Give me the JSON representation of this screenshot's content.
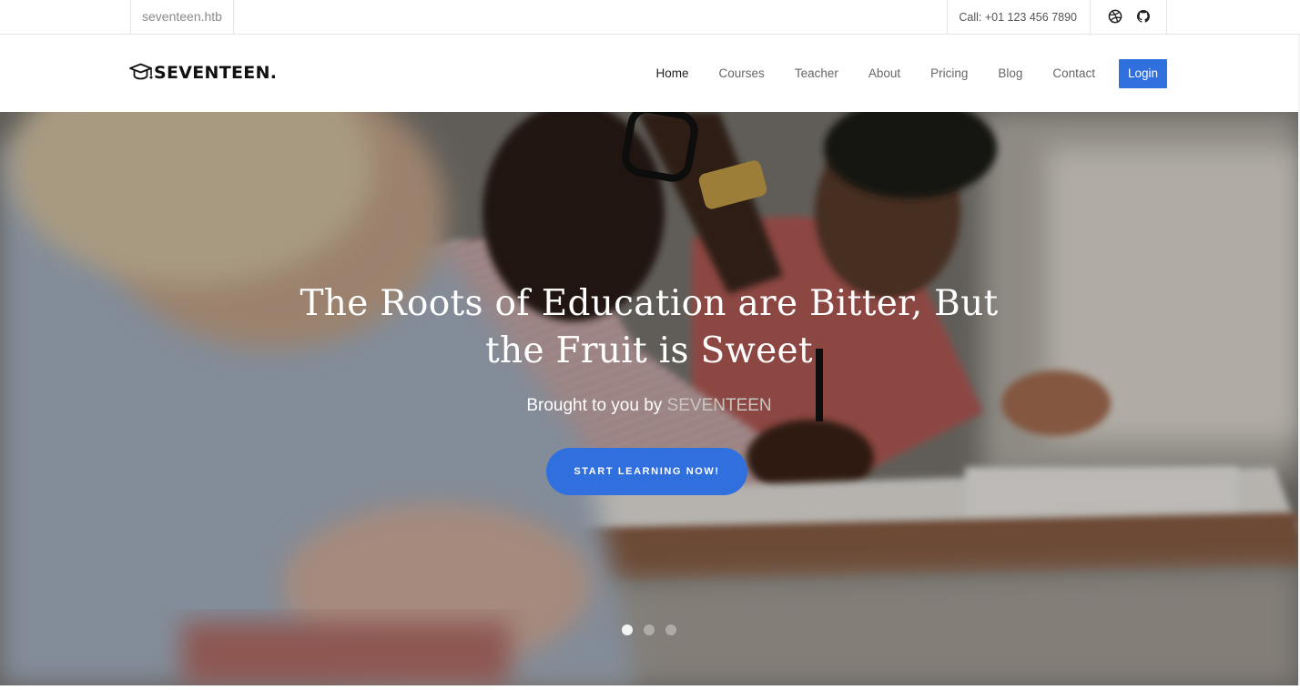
{
  "topbar": {
    "site_name": "seventeen.htb",
    "call_text": "Call: +01 123 456 7890",
    "social_icons": [
      "dribbble-icon",
      "github-icon"
    ]
  },
  "navbar": {
    "logo_icon": "graduation-cap-icon",
    "logo_text": "SEVENTEEN.",
    "items": [
      {
        "label": "Home",
        "active": true
      },
      {
        "label": "Courses"
      },
      {
        "label": "Teacher"
      },
      {
        "label": "About"
      },
      {
        "label": "Pricing"
      },
      {
        "label": "Blog"
      },
      {
        "label": "Contact"
      }
    ],
    "login_label": "Login"
  },
  "hero": {
    "title_line1": "The Roots of Education are Bitter, But",
    "title_line2": "the Fruit is Sweet",
    "subtitle_prefix": "Brought to you by",
    "subtitle_brand": "SEVENTEEN",
    "cta_label": "START LEARNING NOW!",
    "slides": 3,
    "active_slide": 1
  },
  "colors": {
    "accent": "#2f6fde",
    "nav_text": "#666666",
    "nav_active": "#222222",
    "brand_muted": "#c9c6c2"
  }
}
